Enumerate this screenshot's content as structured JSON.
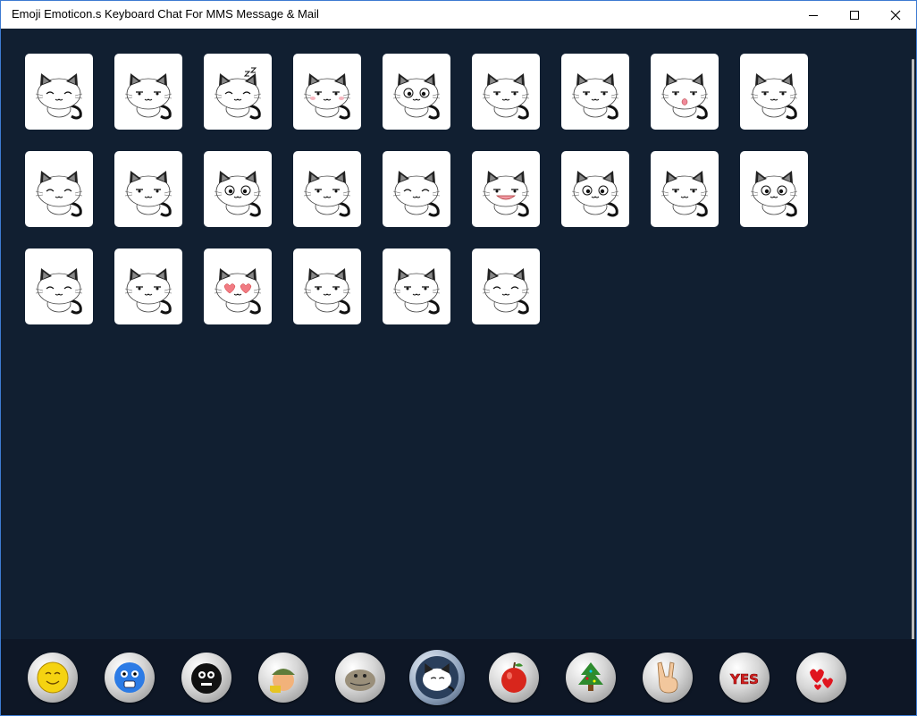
{
  "window": {
    "title": "Emoji Emoticon.s Keyboard Chat For MMS Message & Mail",
    "controls": [
      "minimize-icon",
      "maximize-icon",
      "close-icon"
    ]
  },
  "emoticon_grid": {
    "item_kind": "cat-emoticon",
    "rows": [
      [
        "cat-happy",
        "cat-sweat",
        "cat-sleeping-zzz",
        "cat-blush",
        "cat-dizzy-eyes",
        "cat-smirk",
        "cat-surprised",
        "cat-tongue",
        "cat-annoyed"
      ],
      [
        "cat-laughing",
        "cat-knocked-out",
        "cat-wide-eyes",
        "cat-unamused",
        "cat-sleepy",
        "cat-grinning-teeth",
        "cat-shocked",
        "cat-sweating",
        "cat-sparkle-eyes"
      ],
      [
        "cat-squint",
        "cat-tearful",
        "cat-heart-eyes",
        "cat-sad",
        "cat-shifty",
        "cat-content"
      ]
    ]
  },
  "category_bar": {
    "selected_index": 5,
    "items": [
      {
        "icon": "smiley-face-icon",
        "color": "#f5d311"
      },
      {
        "icon": "blue-scared-face-icon",
        "color": "#2c7be5"
      },
      {
        "icon": "black-blob-face-icon",
        "color": "#111111"
      },
      {
        "icon": "soldier-character-icon",
        "color": "#5f7c3a"
      },
      {
        "icon": "gray-monster-face-icon",
        "color": "#9a8f7a"
      },
      {
        "icon": "white-cat-icon",
        "color": "#ffffff"
      },
      {
        "icon": "red-apple-icon",
        "color": "#d8261c"
      },
      {
        "icon": "christmas-tree-icon",
        "color": "#2e8b2e"
      },
      {
        "icon": "peace-hand-icon",
        "color": "#f2c79d"
      },
      {
        "icon": "yes-text-icon",
        "color": "#d31f1f",
        "text": "YES"
      },
      {
        "icon": "red-hearts-icon",
        "color": "#e0141e"
      }
    ]
  },
  "colors": {
    "background": "#111f31",
    "bottom_bar": "#0e1726",
    "titlebar": "#ffffff",
    "tile": "#ffffff"
  }
}
